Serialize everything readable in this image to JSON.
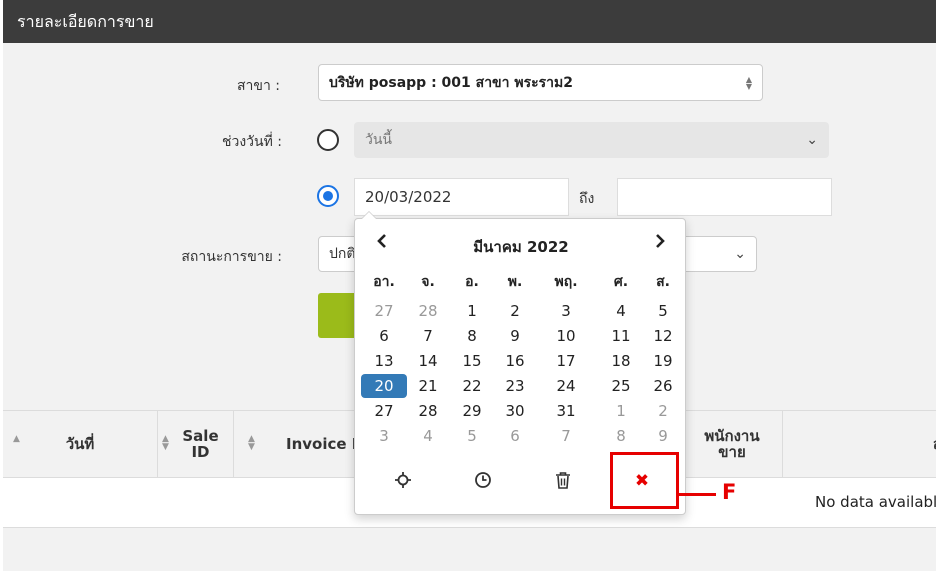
{
  "header": {
    "title": "รายละเอียดการขาย"
  },
  "form": {
    "branch_label": "สาขา :",
    "branch_value": "บริษัท posapp : 001 สาขา พระราม2",
    "date_range_label": "ช่วงวันที่ :",
    "preset_value": "วันนี้",
    "start_date": "20/03/2022",
    "to_label": "ถึง",
    "end_date": "",
    "status_label": "สถานะการขาย :",
    "status_value": "ปกติ"
  },
  "calendar": {
    "prev_icon": "chevron-left-icon",
    "next_icon": "chevron-right-icon",
    "month_title": "มีนาคม 2022",
    "weekdays": [
      "อา.",
      "จ.",
      "อ.",
      "พ.",
      "พฤ.",
      "ศ.",
      "ส."
    ],
    "weeks": [
      [
        "27",
        "28",
        "1",
        "2",
        "3",
        "4",
        "5"
      ],
      [
        "6",
        "7",
        "8",
        "9",
        "10",
        "11",
        "12"
      ],
      [
        "13",
        "14",
        "15",
        "16",
        "17",
        "18",
        "19"
      ],
      [
        "20",
        "21",
        "22",
        "23",
        "24",
        "25",
        "26"
      ],
      [
        "27",
        "28",
        "29",
        "30",
        "31",
        "1",
        "2"
      ],
      [
        "3",
        "4",
        "5",
        "6",
        "7",
        "8",
        "9"
      ]
    ],
    "selected": "20",
    "tools": {
      "today_icon": "crosshair-icon",
      "time_icon": "clock-icon",
      "clear_icon": "trash-icon",
      "close_icon": "close-icon"
    },
    "close_glyph": "✖"
  },
  "table": {
    "columns": [
      "วันที่",
      "Sale ID",
      "Invoice ID",
      "พนักงาน ขาย",
      "ลู"
    ],
    "empty_text": "No data available"
  },
  "annotation": {
    "label": "F",
    "color": "#e60000"
  }
}
